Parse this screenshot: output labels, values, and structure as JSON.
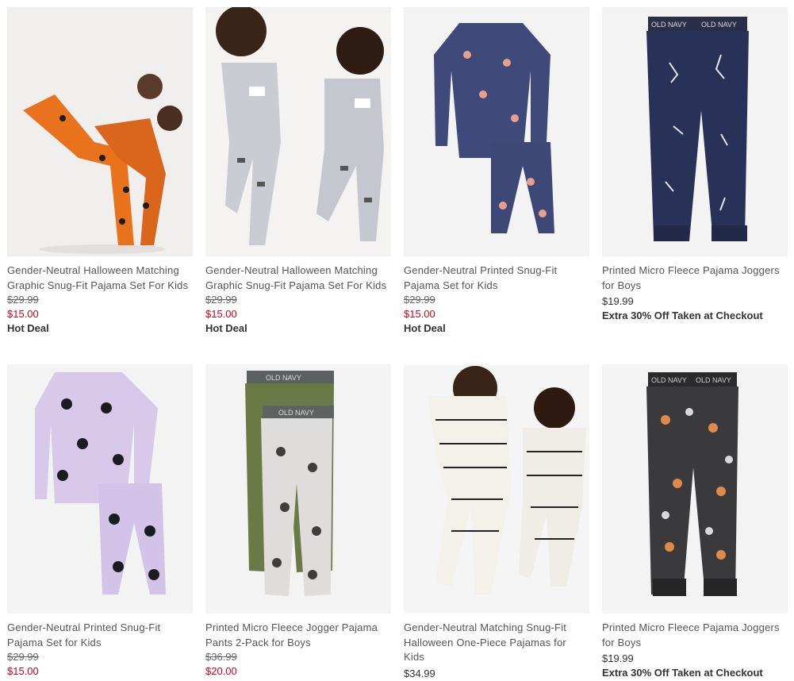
{
  "products": [
    {
      "title": "Gender-Neutral Halloween Matching Graphic Snug-Fit Pajama Set For Kids",
      "old_price": "$29.99",
      "sale_price": "$15.00",
      "deal": "Hot Deal"
    },
    {
      "title": "Gender-Neutral Halloween Matching Graphic Snug-Fit Pajama Set For Kids",
      "old_price": "$29.99",
      "sale_price": "$15.00",
      "deal": "Hot Deal"
    },
    {
      "title": "Gender-Neutral Printed Snug-Fit Pajama Set for Kids",
      "old_price": "$29.99",
      "sale_price": "$15.00",
      "deal": "Hot Deal"
    },
    {
      "title": "Printed Micro Fleece Pajama Joggers for Boys",
      "price": "$19.99",
      "deal": "Extra 30% Off Taken at Checkout"
    },
    {
      "title": "Gender-Neutral Printed Snug-Fit Pajama Set for Kids",
      "old_price": "$29.99",
      "sale_price": "$15.00"
    },
    {
      "title": "Printed Micro Fleece Jogger Pajama Pants 2-Pack for Boys",
      "old_price": "$36.99",
      "sale_price": "$20.00"
    },
    {
      "title": "Gender-Neutral Matching Snug-Fit Halloween One-Piece Pajamas for Kids",
      "old_price": "$34.99"
    },
    {
      "title": "Printed Micro Fleece Pajama Joggers for Boys",
      "price": "$19.99",
      "deal": "Extra 30% Off Taken at Checkout"
    }
  ],
  "brand_waistband": "OLD NAVY",
  "colors": {
    "sale": "#d0021b",
    "text": "#555555",
    "image_bg": "#f2f2f2"
  }
}
